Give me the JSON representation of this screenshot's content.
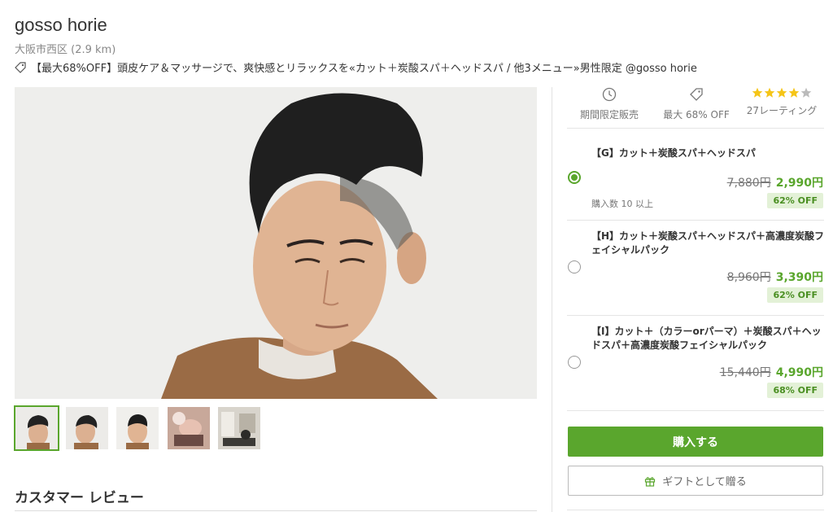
{
  "shop": {
    "title": "gosso horie",
    "location": "大阪市西区 (2.9 km)",
    "headline": "【最大68%OFF】頭皮ケア＆マッサージで、爽快感とリラックスを«カット＋炭酸スパ＋ヘッドスパ / 他3メニュー»男性限定 @gosso horie"
  },
  "stats": {
    "limited_label": "期間限定販売",
    "discount_label": "最大 68% OFF",
    "rating_label": "27レーティング",
    "rating_stars": 4,
    "rating_max": 5
  },
  "options": [
    {
      "title": "【G】カット＋炭酸スパ＋ヘッドスパ",
      "old_price": "7,880円",
      "new_price": "2,990円",
      "badge": "62% OFF",
      "sold": "購入数 10 以上",
      "selected": true
    },
    {
      "title": "【H】カット＋炭酸スパ＋ヘッドスパ＋高濃度炭酸フェイシャルパック",
      "old_price": "8,960円",
      "new_price": "3,390円",
      "badge": "62% OFF",
      "selected": false
    },
    {
      "title": "【I】カット＋（カラーorパーマ）＋炭酸スパ＋ヘッドスパ＋高濃度炭酸フェイシャルパック",
      "old_price": "15,440円",
      "new_price": "4,990円",
      "badge": "68% OFF",
      "selected": false
    }
  ],
  "buttons": {
    "buy": "購入する",
    "gift": "ギフトとして贈る"
  },
  "reviews": {
    "heading": "カスタマー レビュー"
  },
  "icons": {
    "tag": "tag-icon",
    "clock": "clock-icon",
    "star": "star-icon",
    "gift": "gift-icon"
  },
  "colors": {
    "accent": "#5aa62d",
    "badge_bg": "#e3f1d7",
    "star": "#f5c518"
  }
}
